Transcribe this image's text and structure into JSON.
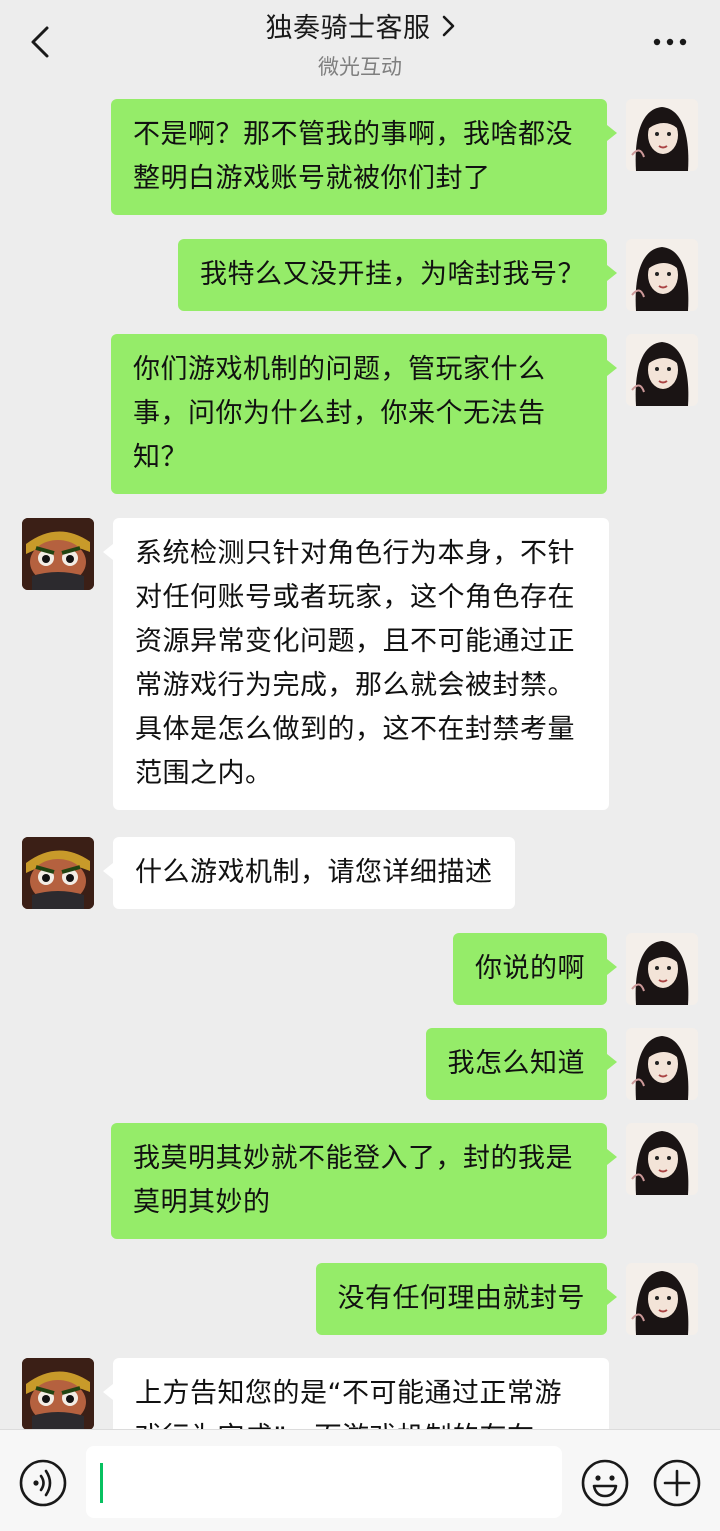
{
  "header": {
    "title": "独奏骑士客服",
    "subtitle": "微光互动",
    "back_icon": "chevron-left-icon",
    "more_icon": "more-dots-icon",
    "title_chevron_icon": "chevron-right-icon"
  },
  "colors": {
    "background": "#ededed",
    "outgoing_bubble": "#95ec69",
    "incoming_bubble": "#ffffff",
    "caret": "#07c160"
  },
  "messages": [
    {
      "sender": "me",
      "text": "不是啊？那不管我的事啊，我啥都没整明白游戏账号就被你们封了"
    },
    {
      "sender": "me",
      "text": "我特么又没开挂，为啥封我号？"
    },
    {
      "sender": "me",
      "text": "你们游戏机制的问题，管玩家什么事，问你为什么封，你来个无法告知？"
    },
    {
      "sender": "agent",
      "text": "系统检测只针对角色行为本身，不针对任何账号或者玩家，这个角色存在资源异常变化问题，且不可能通过正常游戏行为完成，那么就会被封禁。具体是怎么做到的，这不在封禁考量范围之内。"
    },
    {
      "sender": "agent",
      "text": "什么游戏机制，请您详细描述"
    },
    {
      "sender": "me",
      "text": "你说的啊"
    },
    {
      "sender": "me",
      "text": "我怎么知道"
    },
    {
      "sender": "me",
      "text": "我莫明其妙就不能登入了，封的我是莫明其妙的"
    },
    {
      "sender": "me",
      "text": "没有任何理由就封号"
    },
    {
      "sender": "agent",
      "text": "上方告知您的是“不可能通过正常游戏行为完成”，而游戏机制的存在"
    }
  ],
  "input": {
    "value": "",
    "placeholder": "",
    "voice_icon": "voice-icon",
    "emoji_icon": "emoji-icon",
    "plus_icon": "plus-icon"
  }
}
